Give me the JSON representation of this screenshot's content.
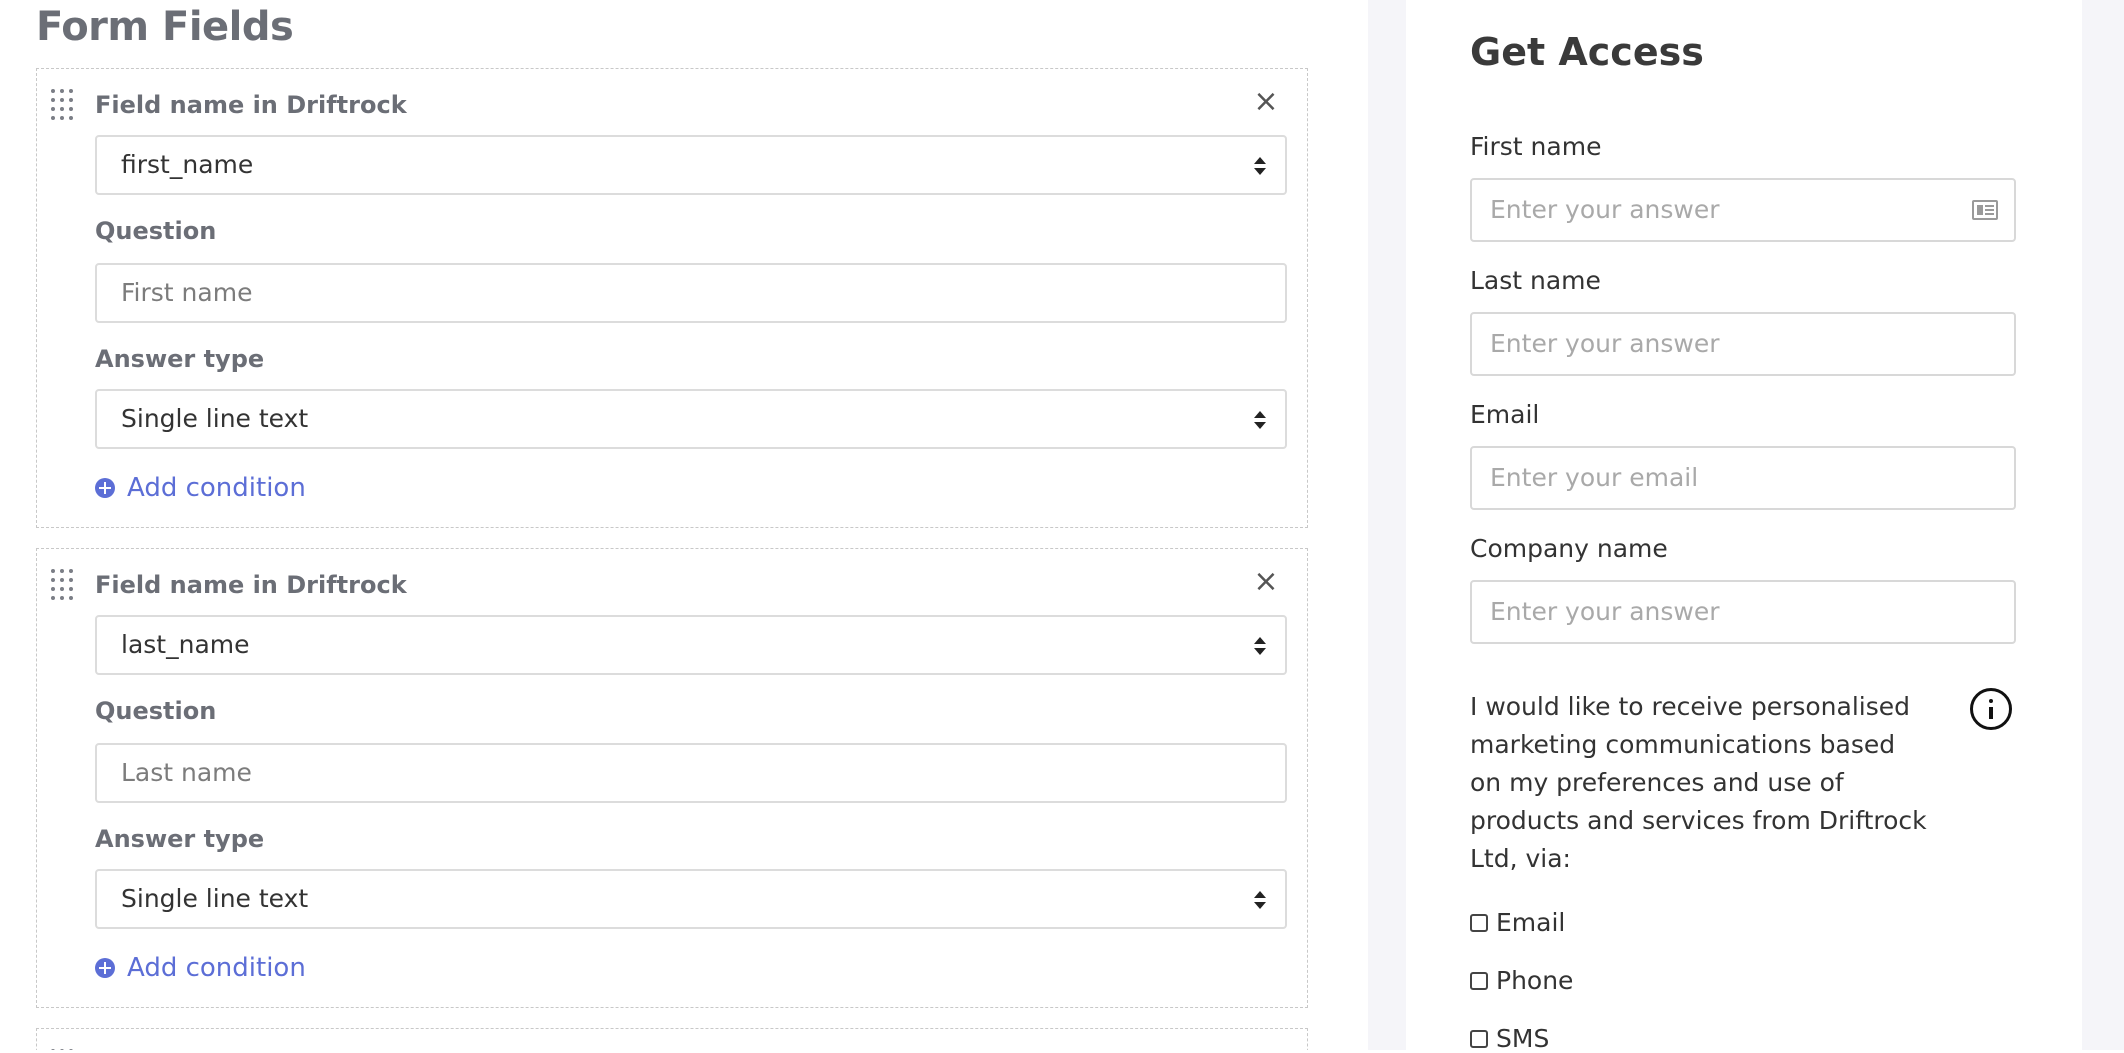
{
  "editor": {
    "section_title": "Form Fields",
    "fields": [
      {
        "field_name_label": "Field name in Driftrock",
        "field_name_value": "first_name",
        "question_label": "Question",
        "question_value": "First name",
        "answer_type_label": "Answer type",
        "answer_type_value": "Single line text",
        "add_condition_label": "Add condition"
      },
      {
        "field_name_label": "Field name in Driftrock",
        "field_name_value": "last_name",
        "question_label": "Question",
        "question_value": "Last name",
        "answer_type_label": "Answer type",
        "answer_type_value": "Single line text",
        "add_condition_label": "Add condition"
      }
    ],
    "remove_symbol": "×"
  },
  "preview": {
    "title": "Get Access",
    "fields": [
      {
        "label": "First name",
        "placeholder": "Enter your answer"
      },
      {
        "label": "Last name",
        "placeholder": "Enter your answer"
      },
      {
        "label": "Email",
        "placeholder": "Enter your email"
      },
      {
        "label": "Company name",
        "placeholder": "Enter your answer"
      }
    ],
    "consent_text": "I would like to receive personalised marketing communications based on my preferences and use of products and services from Driftrock Ltd, via:",
    "channels": [
      "Email",
      "Phone",
      "SMS"
    ]
  },
  "icons": {
    "drag": "drag-handle-icon",
    "remove": "close-icon",
    "add": "plus-circle-icon",
    "info": "info-icon",
    "contact": "contact-card-icon"
  },
  "colors": {
    "accent": "#5c6ed6",
    "label_gray": "#6b6e76",
    "preview_bg": "#f5f5f9"
  }
}
